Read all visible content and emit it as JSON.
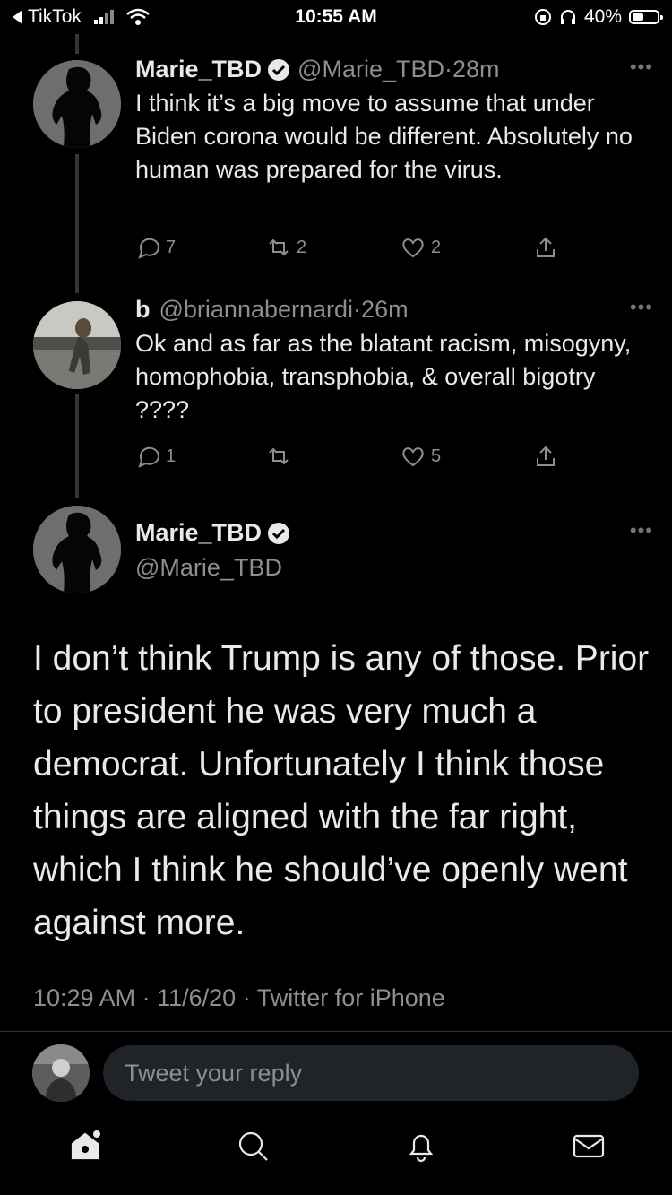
{
  "status_bar": {
    "back_app": "TikTok",
    "time": "10:55 AM",
    "battery": "40%",
    "battery_level": 0.4
  },
  "tweets": [
    {
      "name": "Marie_TBD",
      "verified": true,
      "handle": "@Marie_TBD",
      "age": "28m",
      "text": "I think it’s a big move to assume that under Biden corona would be different. Absolutely no human was prepared for the virus.",
      "replies": "7",
      "retweets": "2",
      "likes": "2"
    },
    {
      "name": "b",
      "verified": false,
      "handle": "@briannabernardi",
      "age": "26m",
      "text": "Ok and as far as the blatant racism, misogyny, homophobia, transphobia, & overall bigotry ????",
      "replies": "1",
      "retweets": "",
      "likes": "5"
    }
  ],
  "main_tweet": {
    "name": "Marie_TBD",
    "verified": true,
    "handle": "@Marie_TBD",
    "text": "I don’t think Trump is any of those. Prior to president he was very much a democrat. Unfortunately I think those things are aligned with the far right, which I think he should’ve openly went against more.",
    "time": "10:29 AM",
    "date": "11/6/20",
    "source": "Twitter for iPhone"
  },
  "reply_box": {
    "placeholder": "Tweet your reply"
  },
  "tab_bar": {
    "icons": [
      "home-icon",
      "search-icon",
      "notifications-icon",
      "messages-icon"
    ]
  },
  "colors": {
    "background": "#000000",
    "text": "#e7e9ea",
    "secondary": "#8b8f94"
  }
}
